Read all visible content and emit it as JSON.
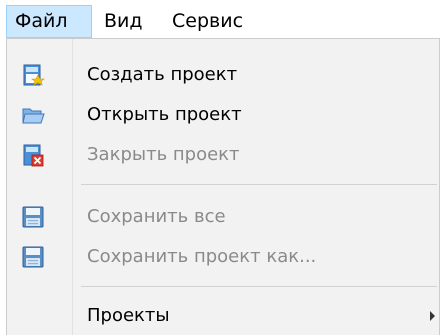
{
  "menubar": {
    "items": [
      {
        "label": "Файл",
        "active": true
      },
      {
        "label": "Вид",
        "active": false
      },
      {
        "label": "Сервис",
        "active": false
      }
    ]
  },
  "dropdown": {
    "items": [
      {
        "label": "Создать проект",
        "icon": "new-project-icon",
        "enabled": true
      },
      {
        "label": "Открыть проект",
        "icon": "open-folder-icon",
        "enabled": true
      },
      {
        "label": "Закрыть проект",
        "icon": "close-project-icon",
        "enabled": false
      },
      {
        "label": "Сохранить все",
        "icon": "save-all-icon",
        "enabled": false
      },
      {
        "label": "Сохранить проект как...",
        "icon": "save-as-icon",
        "enabled": false
      },
      {
        "label": "Проекты",
        "icon": "",
        "enabled": true,
        "submenu": true
      }
    ]
  },
  "colors": {
    "active_menu_bg": "#cce8ff",
    "active_menu_border": "#99d1ff",
    "dropdown_bg": "#f2f2f2",
    "disabled_text": "#8a8a8a"
  }
}
